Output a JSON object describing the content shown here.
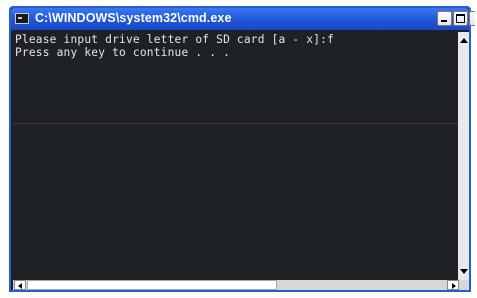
{
  "window": {
    "title": "C:\\WINDOWS\\system32\\cmd.exe",
    "icon": "cmd-icon"
  },
  "titlebar_buttons": {
    "minimize_icon": "minimize-icon",
    "maximize_icon": "maximize-icon",
    "close_icon": "close-icon"
  },
  "console": {
    "lines": [
      "Please input drive letter of SD card [a - x]:f",
      "Press any key to continue . . ."
    ]
  },
  "colors": {
    "titlebar": "#1f55d8",
    "console_background": "#1e2126",
    "console_text": "#e6e6e6"
  }
}
